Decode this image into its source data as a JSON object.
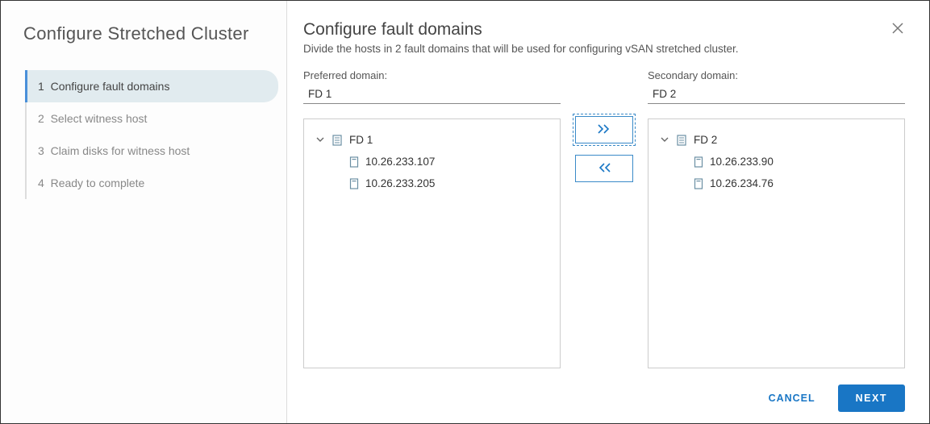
{
  "wizard": {
    "title": "Configure Stretched Cluster",
    "steps": [
      {
        "num": "1",
        "label": "Configure fault domains",
        "active": true
      },
      {
        "num": "2",
        "label": "Select witness host",
        "active": false
      },
      {
        "num": "3",
        "label": "Claim disks for witness host",
        "active": false
      },
      {
        "num": "4",
        "label": "Ready to complete",
        "active": false
      }
    ]
  },
  "page": {
    "title": "Configure fault domains",
    "subtitle": "Divide the hosts in 2 fault domains that will be used for configuring vSAN stretched cluster."
  },
  "preferred": {
    "label": "Preferred domain:",
    "value": "FD 1",
    "group_name": "FD 1",
    "hosts": [
      "10.26.233.107",
      "10.26.233.205"
    ]
  },
  "secondary": {
    "label": "Secondary domain:",
    "value": "FD 2",
    "group_name": "FD 2",
    "hosts": [
      "10.26.233.90",
      "10.26.234.76"
    ]
  },
  "buttons": {
    "cancel": "CANCEL",
    "next": "NEXT"
  }
}
